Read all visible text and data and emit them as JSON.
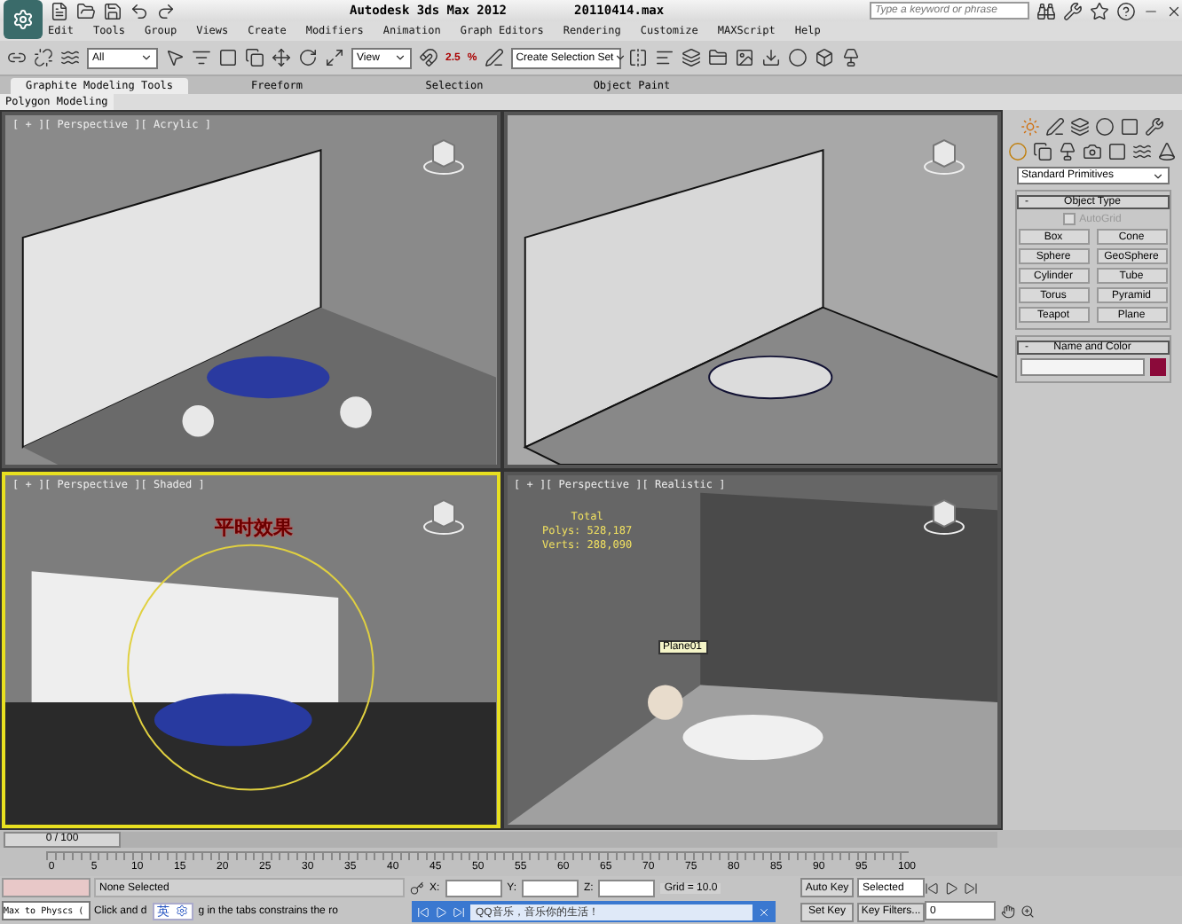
{
  "title_bar": {
    "app": "Autodesk 3ds Max  2012",
    "file": "20110414.max",
    "search": {
      "placeholder": "Type a keyword or phrase"
    }
  },
  "menu": [
    "Edit",
    "Tools",
    "Group",
    "Views",
    "Create",
    "Modifiers",
    "Animation",
    "Graph Editors",
    "Rendering",
    "Customize",
    "MAXScript",
    "Help"
  ],
  "toolbar": {
    "selection_filter": "All",
    "reference_coord": "View",
    "snap_labels": [
      "2.5",
      "%"
    ],
    "selection_set": "Create Selection Set"
  },
  "ribbon": {
    "tabs": [
      {
        "label": "Graphite Modeling Tools",
        "selected": true
      },
      {
        "label": "Freeform",
        "selected": false
      },
      {
        "label": "Selection",
        "selected": false
      },
      {
        "label": "Object Paint",
        "selected": false
      }
    ],
    "panel": "Polygon Modeling"
  },
  "viewports": [
    {
      "kind": "acrylic",
      "label": "[ + ][ Perspective ][ Acrylic ]",
      "active": false
    },
    {
      "kind": "sketch",
      "active": false
    },
    {
      "kind": "shaded",
      "label": "[ + ][ Perspective ][ Shaded ]",
      "active": true,
      "overlay_text": "平时效果"
    },
    {
      "kind": "realistic",
      "label": "[ + ][ Perspective ][ Realistic ]",
      "active": false,
      "stats": [
        "Total",
        "Polys: 528,187",
        "Verts: 288,090"
      ],
      "object_label": "Plane01"
    }
  ],
  "command_panel": {
    "category": "Standard Primitives",
    "object_type": {
      "sign": "-",
      "title": "Object Type",
      "autogrid": {
        "label": "AutoGrid",
        "checked": false,
        "disabled": true
      },
      "buttons": [
        "Box",
        "Cone",
        "Sphere",
        "GeoSphere",
        "Cylinder",
        "Tube",
        "Torus",
        "Pyramid",
        "Teapot",
        "Plane"
      ]
    },
    "name_and_color": {
      "sign": "-",
      "title": "Name and Color",
      "color": "#8b0a3a"
    }
  },
  "timeline": {
    "position": "0 / 100",
    "ticks": [
      "0",
      "5",
      "10",
      "15",
      "20",
      "25",
      "30",
      "35",
      "40",
      "45",
      "50",
      "55",
      "60",
      "65",
      "70",
      "75",
      "80",
      "85",
      "90",
      "95",
      "100"
    ]
  },
  "status": {
    "selection": "None Selected",
    "script_listener": "Max to Physcs (",
    "prompt": [
      "Click and d",
      "g in the tabs constrains the ro"
    ],
    "coords": [
      "X:",
      "Y:",
      "Z:"
    ],
    "grid": "Grid = 10.0"
  },
  "animation": {
    "auto_key": "Auto Key",
    "key_mode": "Selected",
    "set_key": "Set Key",
    "key_filters": "Key Filters...",
    "frame": "0"
  },
  "ime_bar": {
    "label": "英"
  },
  "music_bar": {
    "text": "QQ音乐，音乐你的生活！"
  }
}
